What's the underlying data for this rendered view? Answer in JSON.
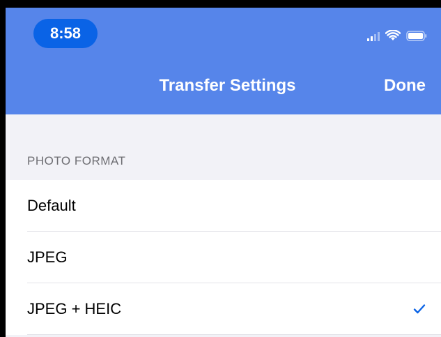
{
  "status_bar": {
    "time": "8:58",
    "icons": [
      "cellular-signal-icon",
      "wifi-icon",
      "battery-icon"
    ]
  },
  "navbar": {
    "title": "Transfer Settings",
    "done_label": "Done",
    "background": "#5685ea"
  },
  "section": {
    "header": "PHOTO FORMAT",
    "options": [
      {
        "label": "Default",
        "selected": false
      },
      {
        "label": "JPEG",
        "selected": false
      },
      {
        "label": "JPEG + HEIC",
        "selected": true
      }
    ]
  },
  "colors": {
    "accent": "#0a63e6",
    "checkmark": "#0a63e6"
  }
}
